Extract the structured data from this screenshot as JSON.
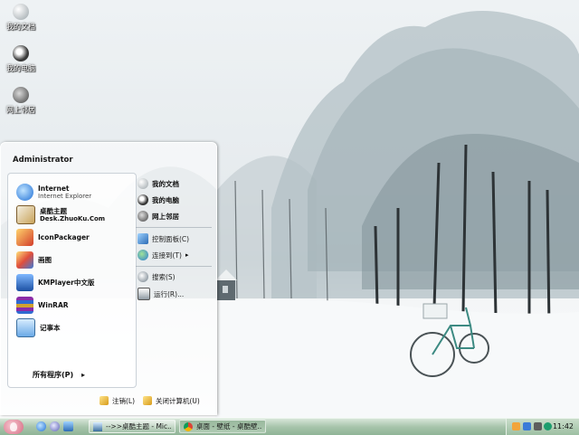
{
  "desktop_icons": [
    {
      "label": "我的文档",
      "icon": "documents-icon"
    },
    {
      "label": "我的电脑",
      "icon": "computer-icon"
    },
    {
      "label": "网上邻居",
      "icon": "network-icon"
    }
  ],
  "start_menu": {
    "user": "Administrator",
    "programs": [
      {
        "title": "Internet",
        "subtitle": "Internet Explorer",
        "icon": "ie-icon"
      },
      {
        "title": "桌酷主题",
        "subtitle": "Desk.ZhuoKu.Com",
        "icon": "zhuoku-icon"
      },
      {
        "title": "IconPackager",
        "subtitle": "",
        "icon": "iconpackager-icon"
      },
      {
        "title": "画图",
        "subtitle": "",
        "icon": "paint-icon"
      },
      {
        "title": "KMPlayer中文版",
        "subtitle": "",
        "icon": "kmplayer-icon"
      },
      {
        "title": "WinRAR",
        "subtitle": "",
        "icon": "winrar-icon"
      },
      {
        "title": "记事本",
        "subtitle": "",
        "icon": "notepad-icon"
      }
    ],
    "all_programs": "所有程序(P)",
    "places": [
      {
        "label": "我的文档",
        "icon": "documents-icon"
      },
      {
        "label": "我的电脑",
        "icon": "computer-icon"
      },
      {
        "label": "网上邻居",
        "icon": "network-icon"
      }
    ],
    "system": [
      {
        "label": "控制面板(C)",
        "icon": "control-panel-icon"
      },
      {
        "label": "连接到(T)",
        "icon": "connect-icon"
      }
    ],
    "tools": [
      {
        "label": "搜索(S)",
        "icon": "search-icon"
      },
      {
        "label": "运行(R)...",
        "icon": "run-icon"
      }
    ],
    "logoff": "注销(L)",
    "shutdown": "关闭计算机(U)"
  },
  "taskbar": {
    "tasks": [
      {
        "label": "-->>桌酷主题 - Mic...",
        "icon": "explorer-window-icon",
        "active": false
      },
      {
        "label": "桌面 - 壁纸 - 桌酷壁...",
        "icon": "chrome-icon",
        "active": true
      }
    ],
    "clock": "11:42"
  },
  "colors": {
    "taskbar": "#a7c4ab",
    "start_button": "#d76e86",
    "snow": "#f4f6f7"
  }
}
